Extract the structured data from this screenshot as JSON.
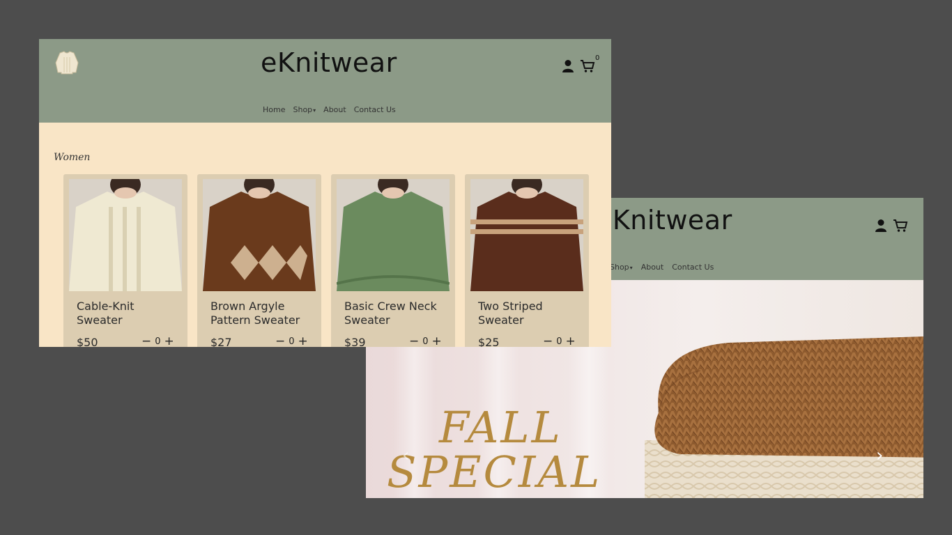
{
  "back_window": {
    "brand": "eKnitwear",
    "nav": [
      {
        "label": "Shop",
        "has_caret": true
      },
      {
        "label": "About",
        "has_caret": false
      },
      {
        "label": "Contact Us",
        "has_caret": false
      }
    ],
    "hero": {
      "line1": "FALL",
      "line2": "SPECIAL",
      "prev_arrow": "‹",
      "next_arrow": "›"
    }
  },
  "front_window": {
    "brand": "eKnitwear",
    "cart_count": "0",
    "nav": [
      {
        "label": "Home",
        "has_caret": false
      },
      {
        "label": "Shop",
        "has_caret": true
      },
      {
        "label": "About",
        "has_caret": false
      },
      {
        "label": "Contact Us",
        "has_caret": false
      }
    ],
    "section_title": "Women",
    "products": [
      {
        "name": "Cable-Knit Sweater",
        "price": "$50",
        "qty": "0",
        "color": "#efe9d2",
        "accent": "#d9d0b2"
      },
      {
        "name": "Brown Argyle Pattern Sweater",
        "price": "$27",
        "qty": "0",
        "color": "#6a3a1c",
        "accent": "#cdb08f"
      },
      {
        "name": "Basic Crew Neck Sweater",
        "price": "$39",
        "qty": "0",
        "color": "#6b8b5e",
        "accent": "#55744a"
      },
      {
        "name": "Two Striped Sweater",
        "price": "$25",
        "qty": "0",
        "color": "#5a2d1c",
        "accent": "#c8a27c"
      }
    ]
  },
  "icons": {
    "user": "user-icon",
    "cart": "cart-icon",
    "minus": "−",
    "plus": "+"
  },
  "colors": {
    "header": "#8c9a87",
    "page_bg": "#f9e5c6",
    "card_bg": "#dccdb1",
    "hero_text": "#b58a3e"
  }
}
